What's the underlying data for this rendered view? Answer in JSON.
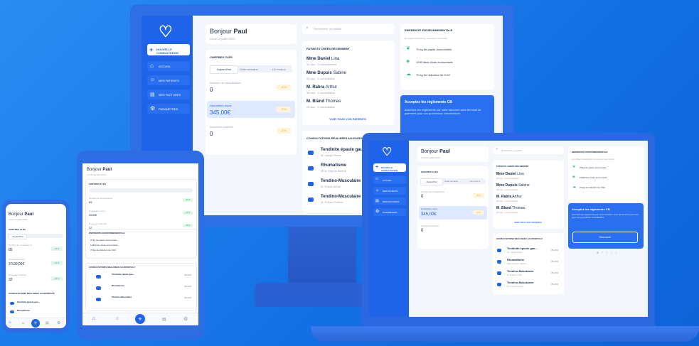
{
  "brand": {
    "logo_icon": "heart-icon",
    "color": "#1f63e8",
    "accent": "#f0a420"
  },
  "sidebar": {
    "new_button": "NOUVELLE CONSULTATION",
    "items": [
      {
        "label": "ACCUEIL",
        "icon": "home-icon"
      },
      {
        "label": "MES PATIENTS",
        "icon": "users-icon"
      },
      {
        "label": "MES FACTURES",
        "icon": "invoice-icon"
      },
      {
        "label": "PARAMÈTRES",
        "icon": "gear-icon"
      }
    ]
  },
  "header": {
    "greeting": "Bonjour",
    "name": "Paul",
    "date": "Lundi 13 juillet 2020"
  },
  "search": {
    "placeholder": "Rechercher un patient"
  },
  "key_figures": {
    "title": "CHIFFRES CLÉS",
    "tabs": [
      "Aujourd'hui",
      "Cette semaine",
      "Ce mois-ci"
    ],
    "rows": [
      {
        "label": "Nombre de consultations",
        "value": "0",
        "badge": "-8 %"
      },
      {
        "label": "Honoraires reçus",
        "value": "345,00€",
        "badge": "-3 %"
      },
      {
        "label": "Nouveaux patients",
        "value": "0",
        "badge": "-4 %"
      }
    ]
  },
  "recent_patients": {
    "title": "PATIENTS CRÉÉS RÉCEMMENT",
    "items": [
      {
        "title": "Mme",
        "first": "Daniel",
        "last": "Lina",
        "meta": "31 ans - 3 consultations"
      },
      {
        "title": "Mme",
        "first": "Dupuis",
        "last": "Sabine",
        "meta": "43 ans - 1 consultation"
      },
      {
        "title": "M.",
        "first": "Rabra",
        "last": "Arthur",
        "meta": "38 ans - 1 consultation"
      },
      {
        "title": "M.",
        "first": "Bland",
        "last": "Thomas",
        "meta": "28 ans - 1 consultation"
      }
    ],
    "link": "VOIR TOUS VOS PATIENTS"
  },
  "footprint": {
    "title": "EMPREINTE ENVIRONNEMENTALE",
    "subtitle": "En utilisant Heartwork, vous avez économisé :",
    "items": [
      {
        "text": "70 kg de papier économisés",
        "icon": "leaf-icon"
      },
      {
        "text": "1230 litres d'eau économisés",
        "icon": "water-drop-icon"
      },
      {
        "text": "70 kg de réduction de CO2",
        "icon": "cloud-icon"
      }
    ]
  },
  "cb_card": {
    "title": "Acceptez les règlements CB",
    "text": "Autorisez les règlements par carte bancaire sans terminal de paiement pour vos prochaines consultations.",
    "button": "Découvrir"
  },
  "consultations": {
    "title": "CONSULTATIONS RÉALISÉES AUJOURD'HUI",
    "items": [
      {
        "name": "Tendinite épaule gau...",
        "patient": "M. Langlo Pierre",
        "price": "35,00 €"
      },
      {
        "name": "Rhumatisme",
        "patient": "Mme Dupuis Sabine",
        "price": "35,00 €"
      },
      {
        "name": "Tendino-Musculaire",
        "patient": "M. Rabra Arthur",
        "price": "35,00 €"
      },
      {
        "name": "Tendino-Musculaire",
        "patient": "M. Poiriez Patrice",
        "price": "35,00 €"
      }
    ]
  },
  "mobile": {
    "stats": [
      {
        "label": "Nombre de consultations",
        "value": "85",
        "badge": "+8 %"
      },
      {
        "label": "Honoraires reçus",
        "value": "3 530,00€",
        "badge": "+3 %"
      },
      {
        "label": "Nouveaux patients",
        "value": "32",
        "badge": "+8 %"
      }
    ],
    "tablet_stats": [
      {
        "label": "Nombre de consultations",
        "value": "85",
        "badge": "+8 %"
      },
      {
        "label": "Honoraires reçus",
        "value": "3530€",
        "badge": "+3 %"
      },
      {
        "label": "Nouveaux patients",
        "value": "32",
        "badge": "+8 %"
      }
    ],
    "nav_icons": [
      "home-icon",
      "users-icon",
      "plus-icon",
      "invoice-icon",
      "gear-icon"
    ]
  }
}
